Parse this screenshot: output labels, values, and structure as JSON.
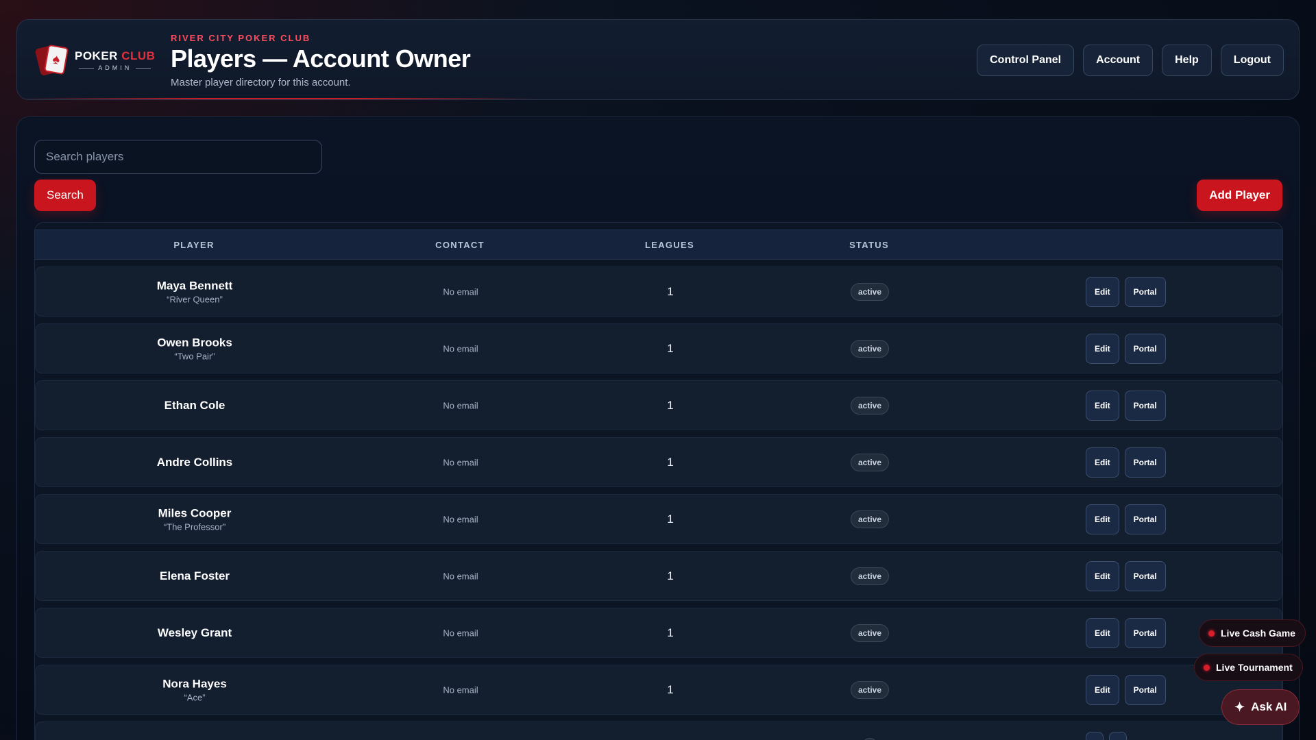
{
  "header": {
    "logo_line1": "POKER",
    "logo_line1_accent": "CLUB",
    "logo_line2": "ADMIN",
    "logo_card_symbol": "♠",
    "eyebrow": "RIVER CITY POKER CLUB",
    "title": "Players — Account Owner",
    "subtitle": "Master player directory for this account.",
    "nav": [
      "Control Panel",
      "Account",
      "Help",
      "Logout"
    ]
  },
  "toolbar": {
    "search_placeholder": "Search players",
    "search_value": "",
    "search_label": "Search",
    "add_label": "Add Player"
  },
  "table": {
    "columns": [
      "PLAYER",
      "CONTACT",
      "LEAGUES",
      "STATUS"
    ],
    "rows": [
      {
        "name": "Maya Bennett",
        "nickname": "“River Queen”",
        "contact": "No email",
        "leagues": "1",
        "status": "active",
        "edit": "Edit",
        "portal": "Portal"
      },
      {
        "name": "Owen Brooks",
        "nickname": "“Two Pair”",
        "contact": "No email",
        "leagues": "1",
        "status": "active",
        "edit": "Edit",
        "portal": "Portal"
      },
      {
        "name": "Ethan Cole",
        "nickname": "",
        "contact": "No email",
        "leagues": "1",
        "status": "active",
        "edit": "Edit",
        "portal": "Portal"
      },
      {
        "name": "Andre Collins",
        "nickname": "",
        "contact": "No email",
        "leagues": "1",
        "status": "active",
        "edit": "Edit",
        "portal": "Portal"
      },
      {
        "name": "Miles Cooper",
        "nickname": "“The Professor”",
        "contact": "No email",
        "leagues": "1",
        "status": "active",
        "edit": "Edit",
        "portal": "Portal"
      },
      {
        "name": "Elena Foster",
        "nickname": "",
        "contact": "No email",
        "leagues": "1",
        "status": "active",
        "edit": "Edit",
        "portal": "Portal"
      },
      {
        "name": "Wesley Grant",
        "nickname": "",
        "contact": "No email",
        "leagues": "1",
        "status": "active",
        "edit": "Edit",
        "portal": "Portal"
      },
      {
        "name": "Nora Hayes",
        "nickname": "“Ace”",
        "contact": "No email",
        "leagues": "1",
        "status": "active",
        "edit": "Edit",
        "portal": "Portal"
      }
    ]
  },
  "floating": {
    "live_cash": "Live Cash Game",
    "live_tournament": "Live Tournament",
    "ask_ai": "Ask AI",
    "ask_ai_icon": "sparkle-icon"
  },
  "colors": {
    "accent_red": "#c8151e",
    "eyebrow_red": "#ff4d5e",
    "background": "#070d18",
    "panel": "#121d30"
  }
}
